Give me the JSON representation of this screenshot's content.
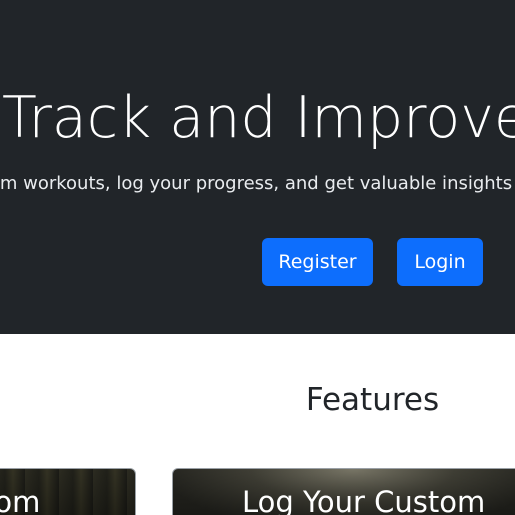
{
  "hero": {
    "title": "Track and Improve",
    "subtitle": "m workouts, log your progress, and get valuable insights",
    "register_label": "Register",
    "login_label": "Login"
  },
  "features": {
    "heading": "Features",
    "cards": [
      {
        "title": "tom"
      },
      {
        "title": "Log Your Custom"
      }
    ]
  },
  "colors": {
    "hero_bg": "#212529",
    "accent": "#0d6efd",
    "page_bg": "#ffffff",
    "text_dark": "#212529"
  }
}
